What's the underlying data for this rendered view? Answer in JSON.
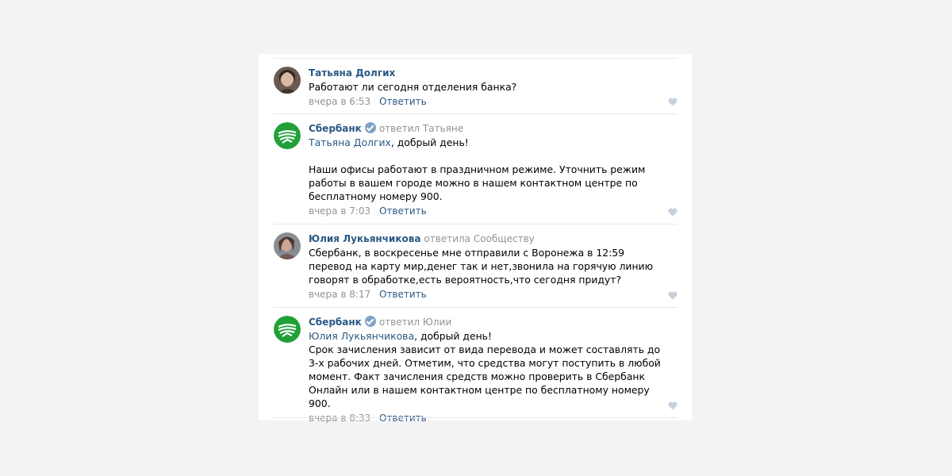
{
  "colors": {
    "link": "#2a5885",
    "muted": "#939393",
    "divider": "#e7e8ec",
    "sber_green": "#21a038",
    "verified_badge": "#7fa3c8",
    "like_heart": "#c5d0db"
  },
  "comments": [
    {
      "author": "Татьяна Долгих",
      "replied_to": "",
      "mention": "",
      "mention_suffix": "",
      "paragraphs": [
        "Работают ли сегодня отделения банка?"
      ],
      "date": "вчера в 6:53",
      "reply_label": "Ответить",
      "avatar": "user-photo",
      "verified": false
    },
    {
      "author": "Сбербанк",
      "replied_to": "ответил Татьяне",
      "mention": "Татьяна Долгих",
      "mention_suffix": ", добрый день!",
      "paragraphs": [
        "",
        "Наши офисы работают в праздничном режиме. Уточнить режим работы в вашем городе можно в нашем контактном центре по бесплатному номеру 900."
      ],
      "date": "вчера в 7:03",
      "reply_label": "Ответить",
      "avatar": "sberbank-logo",
      "verified": true
    },
    {
      "author": "Юлия Лукьянчикова",
      "replied_to": "ответила Сообществу",
      "mention": "",
      "mention_suffix": "",
      "paragraphs": [
        "Сбербанк, в воскресенье мне отправили с Воронежа в 12:59 перевод на карту мир,денег так и нет,звонила на горячую линию говорят в обработке,есть вероятность,что сегодня придут?"
      ],
      "date": "вчера в 8:17",
      "reply_label": "Ответить",
      "avatar": "user-photo",
      "verified": false
    },
    {
      "author": "Сбербанк",
      "replied_to": "ответил Юлии",
      "mention": "Юлия Лукьянчикова",
      "mention_suffix": ", добрый день!",
      "paragraphs": [
        "Срок зачисления зависит от вида перевода и может составлять до 3-х рабочих дней. Отметим, что средства могут поступить в любой момент. Факт зачисления средств можно проверить в Сбербанк Онлайн или в нашем контактном центре по бесплатному номеру 900."
      ],
      "date": "вчера в 8:33",
      "reply_label": "Ответить",
      "avatar": "sberbank-logo",
      "verified": true
    }
  ]
}
